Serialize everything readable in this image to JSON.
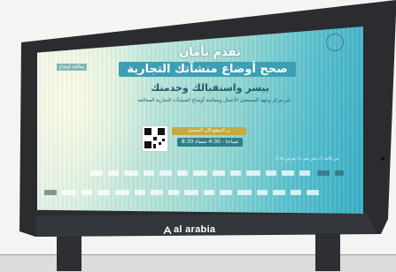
{
  "billboard": {
    "headline_1": "تقدم بأمان",
    "headline_2": "صحح أوضاع منشآتك التجارية",
    "headline_3": "بيسر واستقبالك وخدمتك",
    "body_text": "عبر مركز وجهة المستقبل الأعمال ومعالجة أوضاع المنشآت التجارية المخالفة",
    "qr_caption": "زر الموقع الآن التسجيل",
    "hours": "8:30 صباحا - 4:30 مساء",
    "date_line": "من الأحد ١٣ يناير حتى ١٩ فبراير ٢٠٢٤",
    "top_tag": "معالجة أوضاع",
    "footer_brand": "al arabia",
    "colors": {
      "screen_teal": "#39aec7",
      "headline_bar": "#3c9fb4",
      "gold": "#c7a93d",
      "frame": "#2a2c30"
    }
  }
}
